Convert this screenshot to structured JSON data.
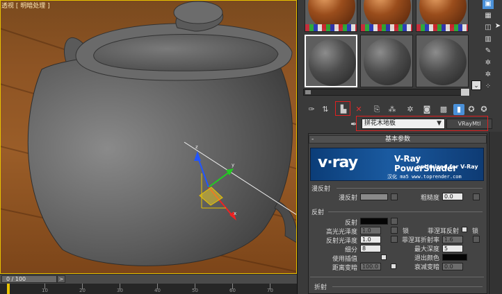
{
  "viewport": {
    "label": "透视 [ 明暗处理 ]"
  },
  "timeline": {
    "slider_text": "0 / 100",
    "next_label": ">",
    "ruler_labels": [
      "10",
      "20",
      "30",
      "40",
      "50",
      "60",
      "70"
    ]
  },
  "material_editor": {
    "material_name": "拼花木地板",
    "material_type": "VRayMtl",
    "dropdown_glyph": "▼",
    "rollout_basic": "基本参数",
    "rollout_refraction": "折射",
    "banner": {
      "logo": "v·ray",
      "title": "V-Ray PowerShader",
      "subtitle": "optimized for V-Ray",
      "credit": "汉化 ma5 www.toprender.com"
    },
    "diffuse_group": {
      "title": "漫反射",
      "diffuse_label": "漫反射",
      "roughness_label": "粗糙度",
      "roughness_value": "0.0"
    },
    "reflection_group": {
      "title": "反射",
      "reflect_label": "反射",
      "hilight_gloss_label": "高光光泽度",
      "hilight_gloss_value": "1.0",
      "refl_gloss_label": "反射光泽度",
      "refl_gloss_value": "1.0",
      "subdivs_label": "细分",
      "subdivs_value": "8",
      "interp_label": "使用插值",
      "dim_dist_label": "距离变暗",
      "dim_dist_value": "100.0",
      "lock_label": "锁",
      "fresnel_label": "菲涅耳反射",
      "fresnel_ior_label": "菲涅耳折射率",
      "fresnel_ior_value": "1.6",
      "max_depth_label": "最大深度",
      "max_depth_value": "5",
      "exit_color_label": "退出颜色",
      "dim_falloff_label": "衰减变暗",
      "dim_falloff_value": "0.0"
    }
  }
}
